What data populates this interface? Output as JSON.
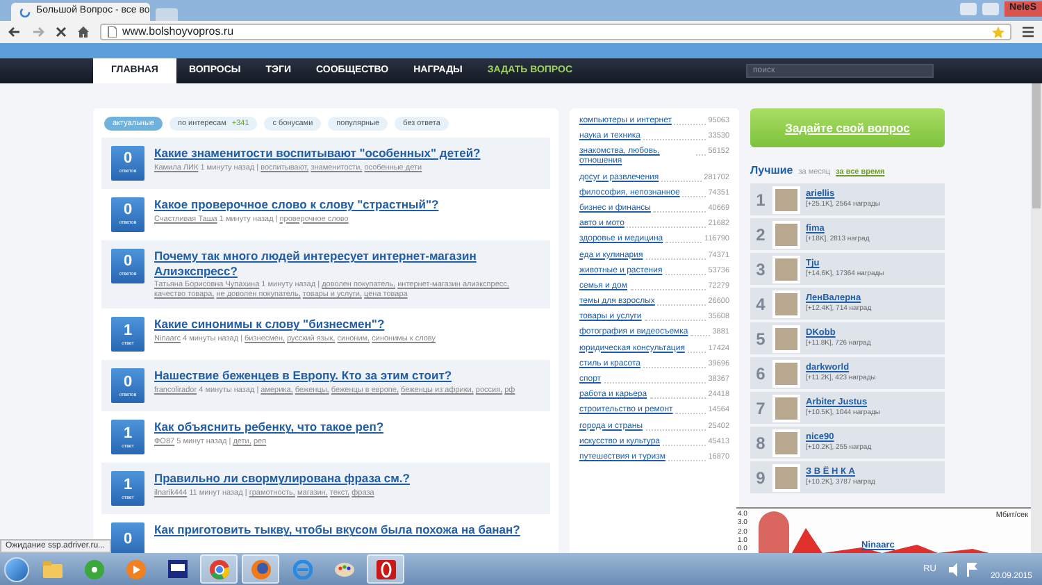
{
  "browser": {
    "tab_title": "Большой Вопрос - все во",
    "loading": true,
    "address": "www.bolshoyvopros.ru",
    "user": "NeleS"
  },
  "nav": {
    "items": [
      {
        "label": "ГЛАВНАЯ",
        "selected": true,
        "kind": "link"
      },
      {
        "label": "ВОПРОСЫ",
        "selected": false,
        "kind": "link"
      },
      {
        "label": "ТЭГИ",
        "selected": false,
        "kind": "link"
      },
      {
        "label": "СООБЩЕСТВО",
        "selected": false,
        "kind": "link"
      },
      {
        "label": "НАГРАДЫ",
        "selected": false,
        "kind": "link"
      },
      {
        "label": "ЗАДАТЬ ВОПРОС",
        "selected": false,
        "kind": "ask"
      }
    ],
    "search": {
      "placeholder": "поиск"
    }
  },
  "filters": [
    {
      "label": "актуальные",
      "selected": true
    },
    {
      "label": "по интересам",
      "selected": false,
      "badge": "+341"
    },
    {
      "label": "с бонусами",
      "selected": false
    },
    {
      "label": "популярные",
      "selected": false
    },
    {
      "label": "без ответа",
      "selected": false
    }
  ],
  "questions": [
    {
      "answers": "0",
      "answers_label": "ответов",
      "title": "Какие знаменитости воспитывают \"особенных\" детей?",
      "author": "Камила ЛИК",
      "time": "1 минуту назад",
      "separator": "|",
      "tags": [
        "воспитывают,",
        "знаменитости,",
        "особенные дети"
      ]
    },
    {
      "answers": "0",
      "answers_label": "ответов",
      "title": "Какое проверочное слово к слову \"страстный\"?",
      "author": "Счастливая Таша",
      "time": "1 минуту назад",
      "separator": "|",
      "tags": [
        "проверочное слово"
      ]
    },
    {
      "answers": "0",
      "answers_label": "ответов",
      "title": "Почему так много людей интересует интернет-магазин Алиэкспресс?",
      "author": "Татьяна Борисовна Чупахина",
      "time": "1 минуту назад",
      "separator": "|",
      "tags": [
        "доволен покупатель,",
        "интернет-магазин алиэкспресс,",
        "качество товара,",
        "не доволен покупатель,",
        "товары и услуги,",
        "цена товара"
      ]
    },
    {
      "answers": "1",
      "answers_label": "ответ",
      "title": "Какие синонимы к слову \"бизнесмен\"?",
      "author": "Ninaarc",
      "time": "4 минуты назад",
      "separator": "|",
      "tags": [
        "бизнесмен,",
        "русский язык,",
        "синоним,",
        "синонимы к слову"
      ]
    },
    {
      "answers": "0",
      "answers_label": "ответов",
      "title": "Нашествие беженцев в Европу. Кто за этим стоит?",
      "author": "francolirador",
      "time": "4 минуты назад",
      "separator": "|",
      "tags": [
        "америка,",
        "беженцы,",
        "беженцы в европе,",
        "беженцы из африки,",
        "россия,",
        "рф"
      ]
    },
    {
      "answers": "1",
      "answers_label": "ответ",
      "title": "Как объяснить ребенку, что такое реп?",
      "author": "ФО87",
      "time": "5 минут назад",
      "separator": "|",
      "tags": [
        "дети,",
        "реп"
      ]
    },
    {
      "answers": "1",
      "answers_label": "ответ",
      "title": "Правильно ли свормулирована фраза см.?",
      "author": "ilnarik444",
      "time": "11 минут назад",
      "separator": "|",
      "tags": [
        "грамотность,",
        "магазин,",
        "текст,",
        "фраза"
      ]
    },
    {
      "answers": "0",
      "title": "Как приготовить тыкву, чтобы вкусом была похожа на банан?"
    }
  ],
  "categories": [
    {
      "name": "компьютеры и интернет",
      "count": "95063"
    },
    {
      "name": "наука и техника",
      "count": "33530"
    },
    {
      "name": "знакомства, любовь, отношения",
      "count": "56152"
    },
    {
      "name": "досуг и развлечения",
      "count": "281702"
    },
    {
      "name": "философия, непознанное",
      "count": "74351"
    },
    {
      "name": "бизнес и финансы",
      "count": "40669"
    },
    {
      "name": "авто и мото",
      "count": "21682"
    },
    {
      "name": "здоровье и медицина",
      "count": "116790"
    },
    {
      "name": "еда и кулинария",
      "count": "74371"
    },
    {
      "name": "животные и растения",
      "count": "53736"
    },
    {
      "name": "семья и дом",
      "count": "72279"
    },
    {
      "name": "темы для взрослых",
      "count": "26600"
    },
    {
      "name": "товары и услуги",
      "count": "35608"
    },
    {
      "name": "фотография и видеосъемка",
      "count": "3881"
    },
    {
      "name": "юридическая консультация",
      "count": "17424"
    },
    {
      "name": "стиль и красота",
      "count": "39696"
    },
    {
      "name": "спорт",
      "count": "38367"
    },
    {
      "name": "работа и карьера",
      "count": "24418"
    },
    {
      "name": "строительство и ремонт",
      "count": "14564"
    },
    {
      "name": "города и страны",
      "count": "25402"
    },
    {
      "name": "искусство и культура",
      "count": "45413"
    },
    {
      "name": "путешествия и туризм",
      "count": "16870"
    }
  ],
  "ask_button": "Задайте свой вопрос",
  "leaders": {
    "title": "Лучшие",
    "periods": [
      {
        "label": "за месяц",
        "selected": false
      },
      {
        "label": "за все время",
        "selected": true
      }
    ],
    "users": [
      {
        "rank": "1",
        "name": "ariellis",
        "stats": "[+25.1K], 2564 награды"
      },
      {
        "rank": "2",
        "name": "fima",
        "stats": "[+18K], 2813 наград"
      },
      {
        "rank": "3",
        "name": "Tju",
        "stats": "[+14.6K], 17364 награды"
      },
      {
        "rank": "4",
        "name": "ЛенВалерна",
        "stats": "[+12.4K], 714 наград"
      },
      {
        "rank": "5",
        "name": "DKobb",
        "stats": "[+11.8K], 726 наград"
      },
      {
        "rank": "6",
        "name": "darkworld",
        "stats": "[+11.2K], 423 награды"
      },
      {
        "rank": "7",
        "name": "Arbiter Justus",
        "stats": "[+10.5K], 1044 награды"
      },
      {
        "rank": "8",
        "name": "nice90",
        "stats": "[+10.2K], 255 наград"
      },
      {
        "rank": "9",
        "name": "З В Ё Н К А",
        "stats": "[+10.2K], 3787 наград"
      }
    ]
  },
  "meter": {
    "unit": "Мбит/сек",
    "axis": [
      "4.0",
      "3.0",
      "2.0",
      "1.0",
      "0.0"
    ],
    "overlay_name": "Ninaarc"
  },
  "status_text": "Ожидание ssp.adriver.ru...",
  "taskbar": {
    "apps": [
      {
        "kind": "folder",
        "selected": false
      },
      {
        "kind": "radio",
        "selected": false
      },
      {
        "kind": "player",
        "selected": false
      },
      {
        "kind": "pm",
        "selected": false
      },
      {
        "kind": "chrome",
        "selected": true
      },
      {
        "kind": "firefox",
        "selected": true
      },
      {
        "kind": "ie",
        "selected": false
      },
      {
        "kind": "paint",
        "selected": false
      },
      {
        "kind": "opera",
        "selected": true
      }
    ],
    "language": "RU",
    "date": "20.09.2015"
  }
}
